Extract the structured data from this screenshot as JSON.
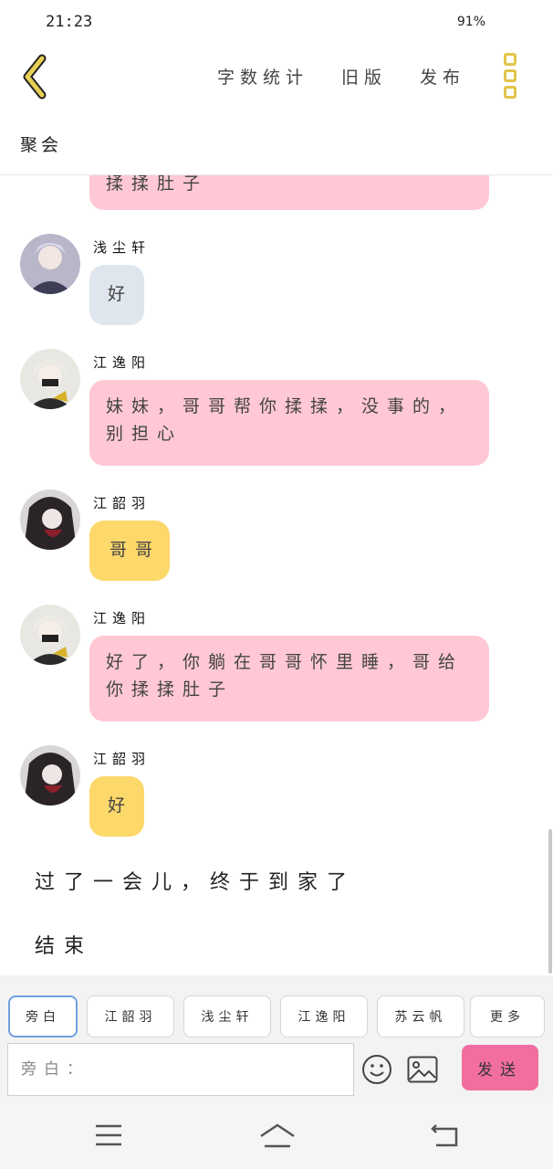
{
  "status": {
    "time": "21:23",
    "battery": "91%"
  },
  "header": {
    "title": "聚会",
    "actions": {
      "word_count": "字数统计",
      "old_version": "旧版",
      "publish": "发布"
    }
  },
  "messages": [
    {
      "type": "pink",
      "text": "揉揉肚子"
    },
    {
      "sender": "浅尘轩",
      "type": "blue",
      "text": "好"
    },
    {
      "sender": "江逸阳",
      "type": "pink",
      "text": "妹妹，哥哥帮你揉揉，没事的，别担心"
    },
    {
      "sender": "江韶羽",
      "type": "yellow",
      "text": "哥哥"
    },
    {
      "sender": "江逸阳",
      "type": "pink",
      "text": "好了，你躺在哥哥怀里睡，哥给你揉揉肚子"
    },
    {
      "sender": "江韶羽",
      "type": "yellow",
      "text": "好"
    }
  ],
  "narration": [
    "过了一会儿，终于到家了",
    "结束"
  ],
  "roles": [
    "旁白",
    "江韶羽",
    "浅尘轩",
    "江逸阳",
    "苏云帆",
    "更多"
  ],
  "input": {
    "placeholder": "旁白："
  },
  "send_label": "发送",
  "colors": {
    "pink": "#ffc8d4",
    "yellow": "#fdd86a",
    "blue": "#dfe6ee",
    "send": "#f26ea0",
    "accent": "#e2c44a"
  },
  "icons": [
    "back-icon",
    "more-icon",
    "emoji-icon",
    "image-icon",
    "menu-icon",
    "home-icon",
    "back-nav-icon"
  ]
}
